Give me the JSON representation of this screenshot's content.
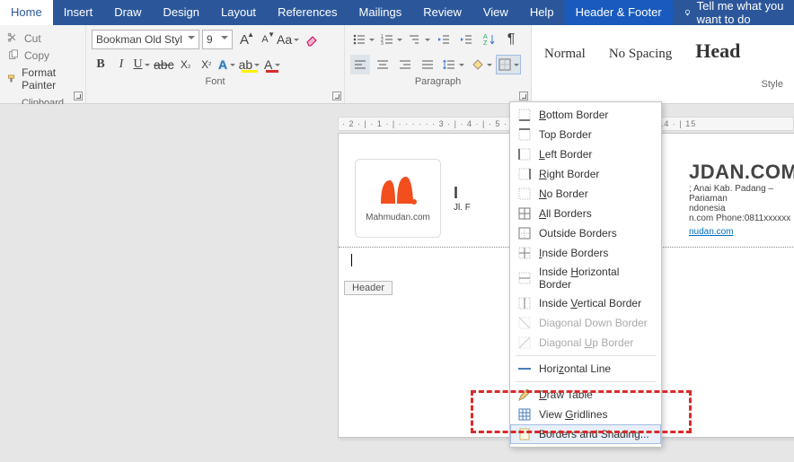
{
  "tabs": [
    "Home",
    "Insert",
    "Draw",
    "Design",
    "Layout",
    "References",
    "Mailings",
    "Review",
    "View",
    "Help"
  ],
  "activeTab": "Home",
  "contextualTab": "Header & Footer",
  "tellMe": {
    "placeholder": "Tell me what you want to do"
  },
  "clipboard": {
    "cut": "Cut",
    "copy": "Copy",
    "formatPainter": "Format Painter",
    "label": "Clipboard"
  },
  "font": {
    "name": "Bookman Old Styl",
    "size": "9",
    "bold": "B",
    "italic": "I",
    "underline": "U",
    "strike": "abc",
    "subscript": "X",
    "superscript": "X",
    "growFont": "A",
    "shrinkFont": "A",
    "changeCase": "Aa",
    "fontColorLetter": "A",
    "highlightGlyph": "ab",
    "effectsGlyph": "A",
    "label": "Font"
  },
  "paragraph": {
    "label": "Paragraph",
    "pilcrow": "¶",
    "sortGlyph": "A↓"
  },
  "stylesGroup": {
    "items": [
      "Normal",
      "No Spacing",
      "Head"
    ],
    "label": "Style"
  },
  "ruler": "· 2 · | · 1 · | ·  ·  ·  ·  ·  · 3 · | · 4 · | · 5 · | · 6  · · ·     10 · | 11 · | 12 · | 13 · | 14 · | 15",
  "document": {
    "logoCaption": "Mahmudan.com",
    "headlinePrefix": "I",
    "subline": "Jl. F",
    "brand": "JDAN.COM",
    "addr1": "; Anai Kab. Padang – Pariaman",
    "addr2": "ndonesia",
    "addr3": "n.com Phone:0811xxxxxx",
    "link": "nudan.com",
    "headerTag": "Header"
  },
  "dropdown": {
    "items": [
      {
        "label": "Bottom Border",
        "m": "B",
        "icon": "border-bottom"
      },
      {
        "label": "Top Border",
        "m": "P",
        "icon": "border-top"
      },
      {
        "label": "Left Border",
        "m": "L",
        "icon": "border-left"
      },
      {
        "label": "Right Border",
        "m": "R",
        "icon": "border-right"
      },
      {
        "label": "No Border",
        "m": "N",
        "icon": "border-none"
      },
      {
        "label": "All Borders",
        "m": "A",
        "icon": "border-all"
      },
      {
        "label": "Outside Borders",
        "m": "S",
        "icon": "border-out"
      },
      {
        "label": "Inside Borders",
        "m": "I",
        "icon": "border-in"
      },
      {
        "label": "Inside Horizontal Border",
        "m": "H",
        "icon": "border-ih"
      },
      {
        "label": "Inside Vertical Border",
        "m": "V",
        "icon": "border-iv"
      },
      {
        "label": "Diagonal Down Border",
        "m": "W",
        "icon": "border-dd",
        "disabled": true
      },
      {
        "label": "Diagonal Up Border",
        "m": "U",
        "icon": "border-du",
        "disabled": true
      }
    ],
    "sep1": true,
    "horizontalLine": {
      "label": "Horizontal Line",
      "m": "Z",
      "icon": "hr-line"
    },
    "sep2": true,
    "drawTable": {
      "label": "Draw Table",
      "m": "D",
      "icon": "pencil"
    },
    "viewGridlines": {
      "label": "View Gridlines",
      "m": "G",
      "icon": "grid"
    },
    "bordersShading": {
      "label": "Borders and Shading...",
      "m": "O",
      "icon": "page",
      "hover": true
    }
  }
}
